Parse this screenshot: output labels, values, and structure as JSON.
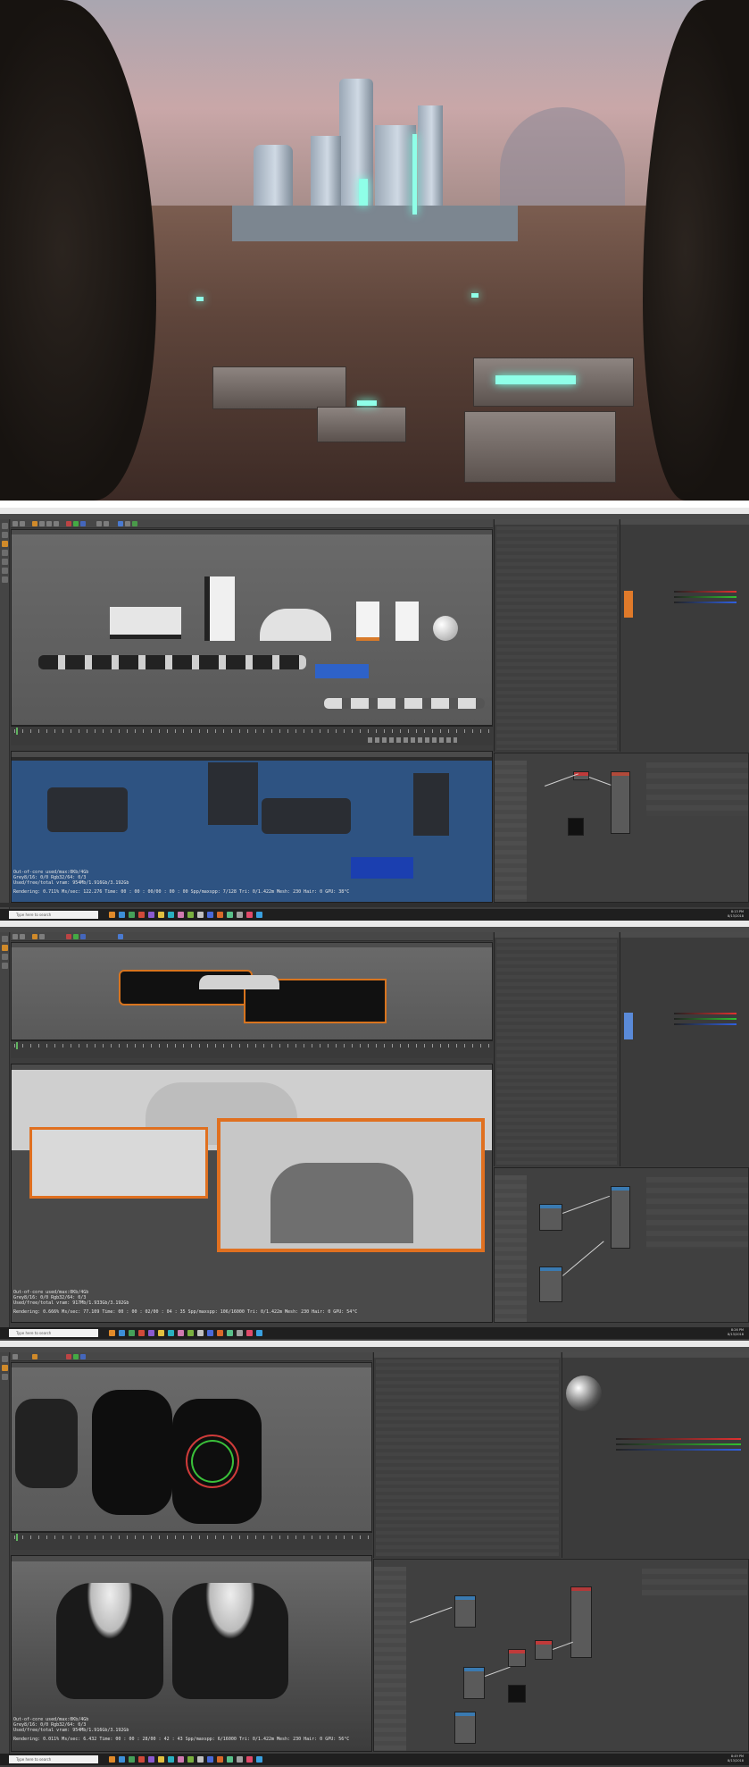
{
  "frame1": {
    "render_stats": {
      "line1": "Out-of-core used/max:0Kb/4Gb",
      "line2": "Grey8/16: 0/0          Rgb32/64: 0/3",
      "line3": "Used/free/total vram: 954Mb/1.916Gb/3.192Gb",
      "line4": "Rendering: 0.711%   Ms/sec: 122.276   Time: 00 : 00 : 00/00 : 00 : 00   Spp/maxspp: 7/128   Tri: 0/1.422m   Mesh: 230   Hair: 0   GPU: 38°C"
    },
    "taskbar": {
      "search": "Type here to search",
      "time": "8:13 PM",
      "date": "8/13/2018"
    }
  },
  "frame2": {
    "render_stats": {
      "line1": "Out-of-core used/max:0Kb/4Gb",
      "line2": "Grey8/16: 0/0          Rgb32/64: 0/3",
      "line3": "Used/free/total vram: 917Mb/1.933Gb/3.192Gb",
      "line4": "Rendering: 0.666%   Ms/sec: 77.109   Time: 00 : 00 : 02/00 : 04 : 35   Spp/maxspp: 106/16000   Tri: 0/1.422m   Mesh: 230   Hair: 0   GPU: 54°C"
    },
    "taskbar": {
      "search": "Type here to search",
      "time": "8:26 PM",
      "date": "8/13/2018"
    }
  },
  "frame3": {
    "render_stats": {
      "line1": "Out-of-core used/max:0Kb/4Gb",
      "line2": "Grey8/16: 0/0          Rgb32/64: 0/3",
      "line3": "Used/free/total vram: 954Mb/1.916Gb/3.192Gb",
      "line4": "Rendering: 0.011%   Ms/sec: 6.432   Time: 00 : 00 : 28/00 : 42 : 43   Spp/maxspp: 6/16000   Tri: 0/1.422m   Mesh: 230   Hair: 0   GPU: 56°C"
    },
    "taskbar": {
      "search": "Type here to search",
      "time": "8:49 PM",
      "date": "8/13/2018"
    }
  },
  "icons": {
    "taskbar_colors": [
      "#e08a2a",
      "#3d8fd8",
      "#45a05a",
      "#d04a3a",
      "#8a5ad0",
      "#e0c040",
      "#2ab0c0",
      "#d07ab0",
      "#7ab040",
      "#c0c0c0",
      "#4a6ad8",
      "#d86a2a",
      "#5ac08a",
      "#a0a0a0",
      "#e04a6a",
      "#3aa0e0"
    ]
  }
}
